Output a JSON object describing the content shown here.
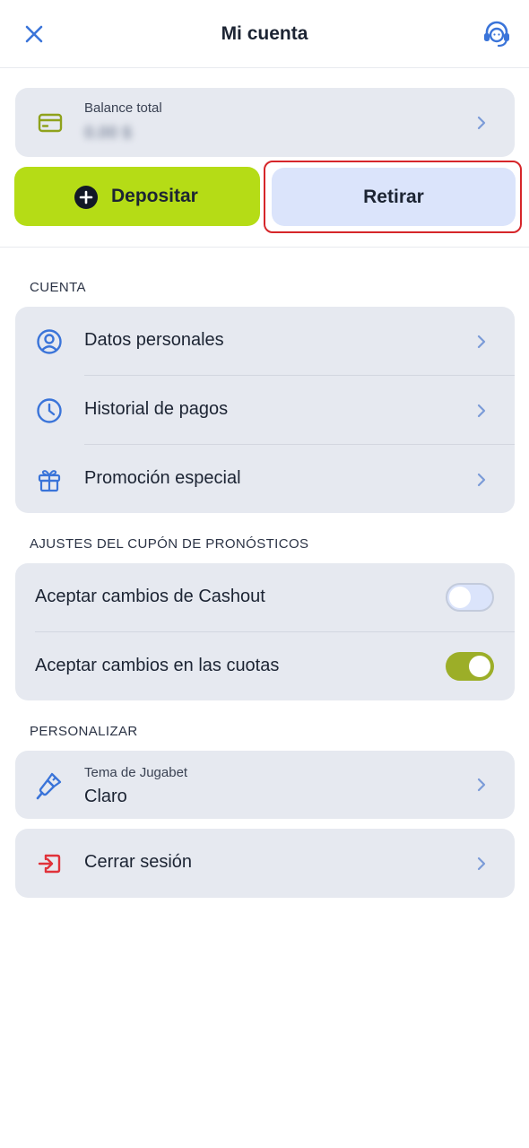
{
  "header": {
    "title": "Mi cuenta",
    "close_icon": "close-icon",
    "support_icon": "headset-icon"
  },
  "balance": {
    "label": "Balance total",
    "value": "0.00 $",
    "icon": "credit-card-icon"
  },
  "actions": {
    "deposit_label": "Depositar",
    "withdraw_label": "Retirar"
  },
  "sections": {
    "account": {
      "title": "CUENTA",
      "items": [
        {
          "label": "Datos personales",
          "icon": "user-circle-icon"
        },
        {
          "label": "Historial de pagos",
          "icon": "clock-icon"
        },
        {
          "label": "Promoción especial",
          "icon": "gift-icon"
        }
      ]
    },
    "coupon": {
      "title": "AJUSTES DEL CUPÓN DE PRONÓSTICOS",
      "toggles": [
        {
          "label": "Aceptar cambios de Cashout",
          "on": false
        },
        {
          "label": "Aceptar cambios en las cuotas",
          "on": true
        }
      ]
    },
    "personalize": {
      "title": "PERSONALIZAR",
      "theme_label": "Tema de Jugabet",
      "theme_value": "Claro",
      "theme_icon": "paintbrush-icon"
    },
    "logout": {
      "label": "Cerrar sesión",
      "icon": "logout-icon"
    }
  },
  "colors": {
    "accent_blue": "#3a74d9",
    "deposit_green": "#b5dc16",
    "withdraw_blue": "#dbe4fb",
    "toggle_on": "#9cae28",
    "logout_red": "#e0323a",
    "highlight_red": "#d6262a"
  }
}
